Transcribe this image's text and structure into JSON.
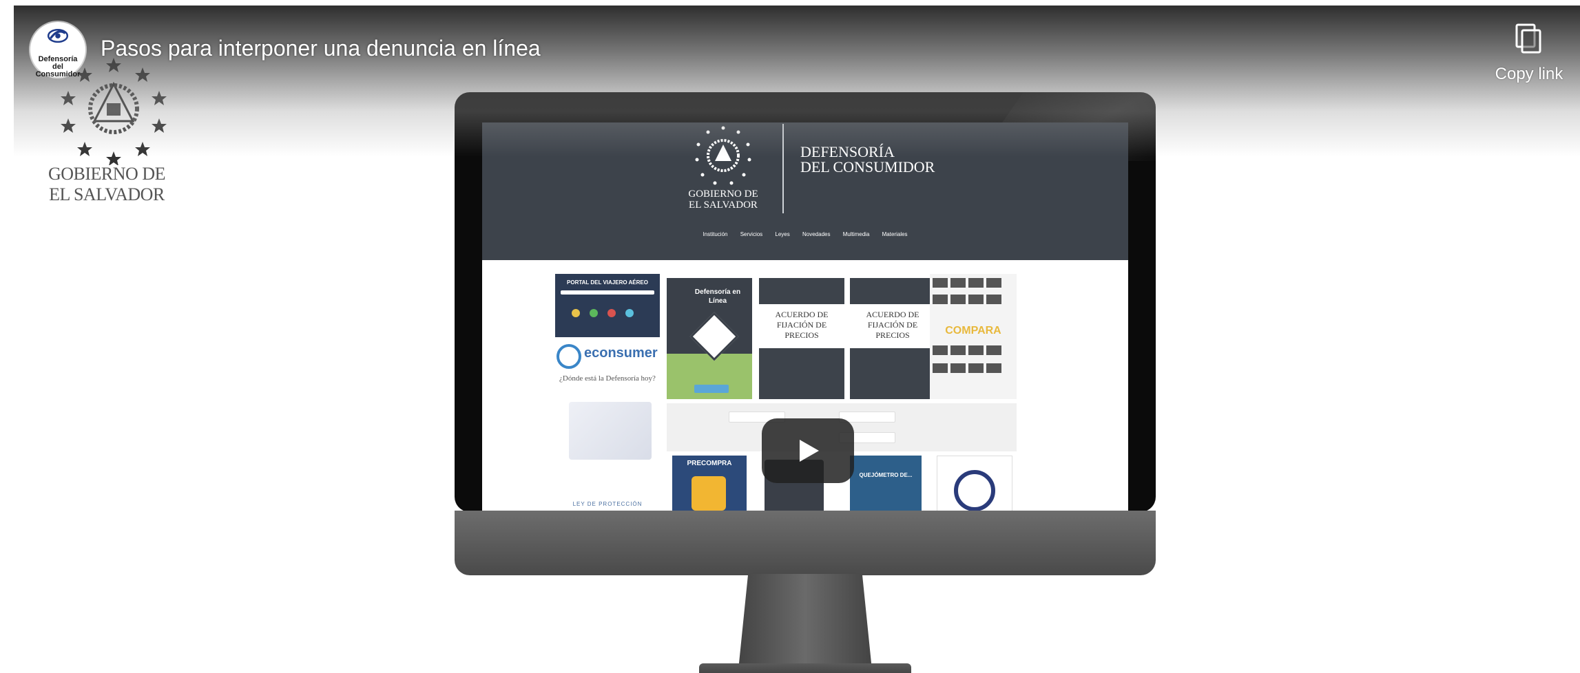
{
  "video": {
    "title": "Pasos para interponer una denuncia en línea",
    "channel_avatar_text": "Defensoría del Consumidor",
    "copy_link_label": "Copy link",
    "play_label": "Play"
  },
  "overlay_logo": {
    "text_line1": "GOBIERNO DE",
    "text_line2": "EL SALVADOR"
  },
  "site": {
    "gov_text": "GOBIERNO DE\nEL SALVADOR",
    "brand": "DEFENSORÍA\nDEL CONSUMIDOR",
    "nav": [
      "Institución",
      "Servicios",
      "Leyes",
      "Novedades",
      "Multimedia",
      "Materiales"
    ],
    "tiles": {
      "portal": "PORTAL DEL VIAJERO AÉREO",
      "defensoria_en_linea": "Defensoría en Línea",
      "acuerdo_1": "ACUERDO DE FIJACIÓN DE PRECIOS",
      "acuerdo_2": "ACUERDO DE FIJACIÓN DE PRECIOS",
      "compara": "COMPARA",
      "econsumer": "econsumer",
      "donde": "¿Dónde está la Defensoría hoy?",
      "ley": "LEY DE PROTECCIÓN",
      "precompra": "PRECOMPRA",
      "quejas": "QUEJÓMETRO DE..."
    }
  },
  "colors": {
    "site_header": "#3d434b",
    "play_button": "#212121",
    "accent_blue": "#2a3b7a",
    "green": "#9ac26b"
  }
}
